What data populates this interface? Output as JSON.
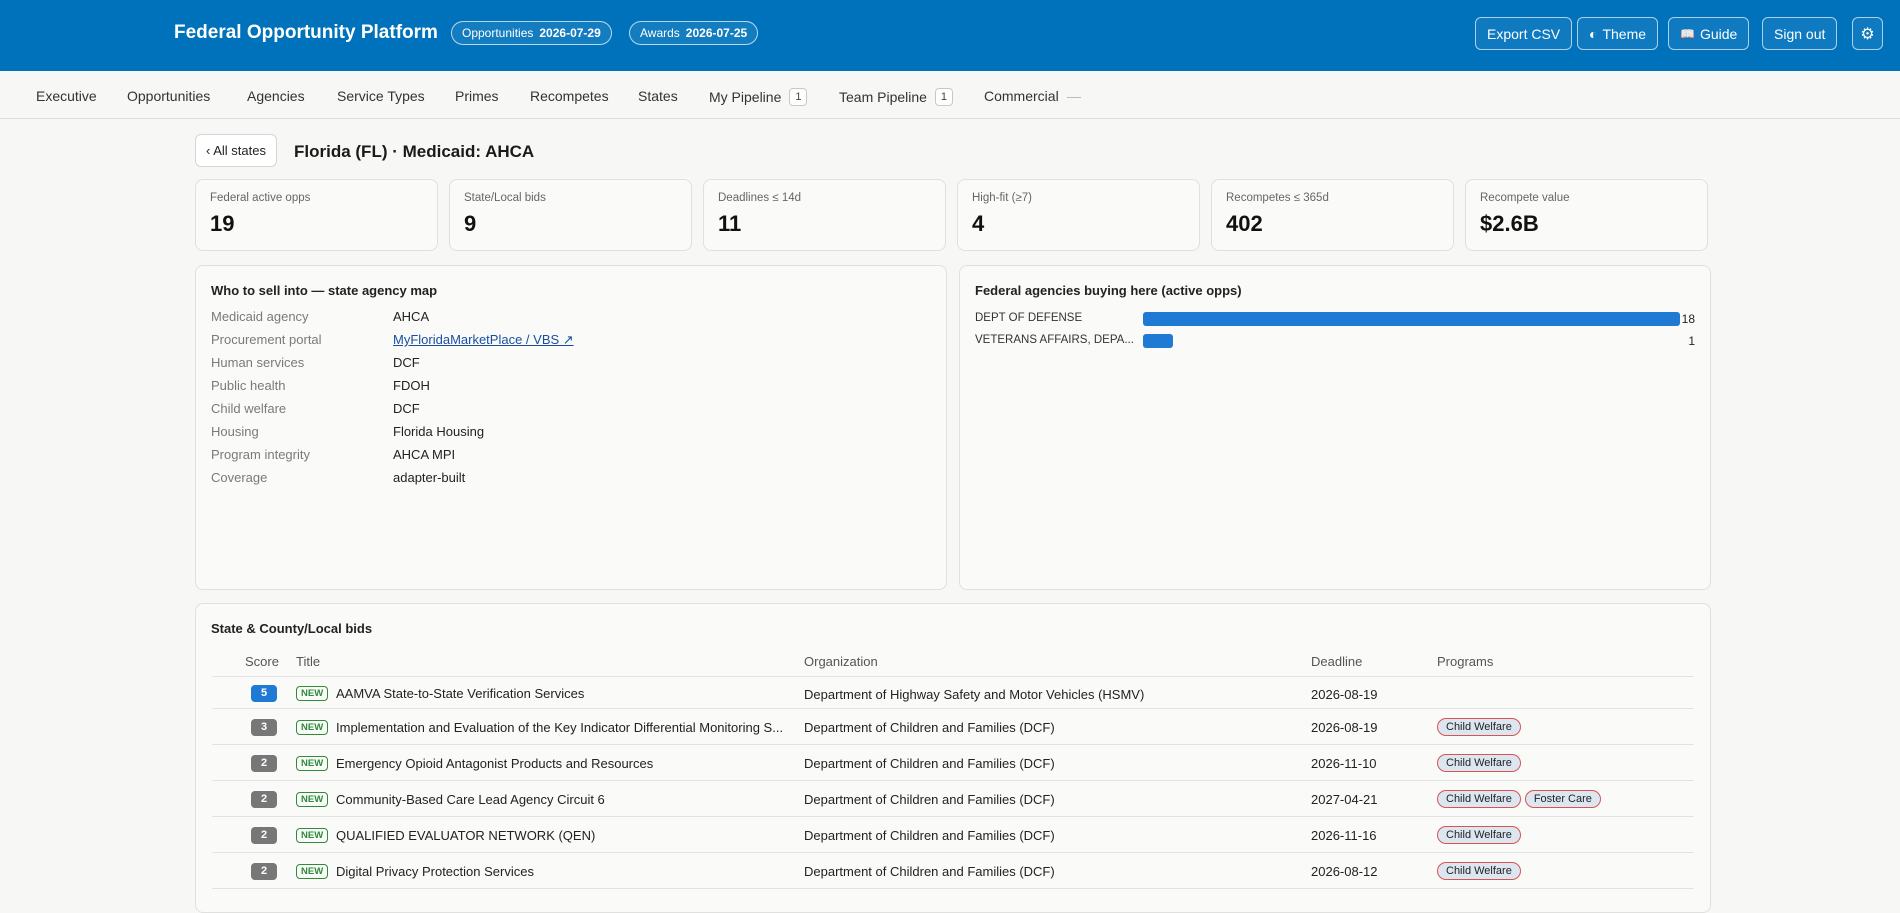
{
  "header": {
    "title": "Federal Opportunity Platform",
    "pills": [
      {
        "label": "Opportunities",
        "date": "2026-07-29"
      },
      {
        "label": "Awards",
        "date": "2026-07-25"
      }
    ],
    "buttons": {
      "export": "Export CSV",
      "theme": "Theme",
      "guide": "Guide",
      "signout": "Sign out"
    },
    "icons": {
      "theme": "◐",
      "guide": "📖",
      "settings": "⚙"
    }
  },
  "nav": {
    "items": [
      {
        "label": "Executive"
      },
      {
        "label": "Opportunities"
      },
      {
        "label": "Agencies"
      },
      {
        "label": "Service Types"
      },
      {
        "label": "Primes"
      },
      {
        "label": "Recompetes"
      },
      {
        "label": "States"
      },
      {
        "label": "My Pipeline",
        "badge": "1"
      },
      {
        "label": "Team Pipeline",
        "badge": "1"
      },
      {
        "label": "Commercial"
      }
    ]
  },
  "page": {
    "back_label": "‹ All states",
    "title": "Florida (FL) · Medicaid: AHCA"
  },
  "kpis": [
    {
      "label": "Federal active opps",
      "value": "19"
    },
    {
      "label": "State/Local bids",
      "value": "9"
    },
    {
      "label": "Deadlines ≤ 14d",
      "value": "11"
    },
    {
      "label": "High-fit (≥7)",
      "value": "4"
    },
    {
      "label": "Recompetes ≤ 365d",
      "value": "402"
    },
    {
      "label": "Recompete value",
      "value": "$2.6B"
    }
  ],
  "agency_map": {
    "title": "Who to sell into — state agency map",
    "rows": [
      {
        "key": "Medicaid agency",
        "value": "AHCA"
      },
      {
        "key": "Procurement portal",
        "value": "MyFloridaMarketPlace / VBS ↗"
      },
      {
        "key": "Human services",
        "value": "DCF"
      },
      {
        "key": "Public health",
        "value": "FDOH"
      },
      {
        "key": "Child welfare",
        "value": "DCF"
      },
      {
        "key": "Housing",
        "value": "Florida Housing"
      },
      {
        "key": "Program integrity",
        "value": "AHCA MPI"
      },
      {
        "key": "Coverage",
        "value": "adapter-built"
      }
    ]
  },
  "federal_agencies": {
    "title": "Federal agencies buying here (active opps)"
  },
  "chart_data": {
    "type": "bar",
    "orientation": "horizontal",
    "categories": [
      "DEPT OF DEFENSE",
      "VETERANS AFFAIRS, DEPA..."
    ],
    "values": [
      18,
      1
    ],
    "title": "Federal agencies buying here (active opps)",
    "xlim": [
      0,
      18
    ],
    "colors": {
      "bar": "#1f7ad4"
    }
  },
  "bids": {
    "title": "State & County/Local bids",
    "columns": {
      "score": "Score",
      "title": "Title",
      "organization": "Organization",
      "deadline": "Deadline",
      "programs": "Programs"
    },
    "new_label": "NEW",
    "rows": [
      {
        "score": "5",
        "title": "AAMVA State-to-State Verification Services",
        "organization": "Department of Highway Safety and Motor Vehicles (HSMV)",
        "deadline": "2026-08-19",
        "programs": []
      },
      {
        "score": "3",
        "title": "Implementation and Evaluation of the Key Indicator Differential Monitoring S...",
        "organization": "Department of Children and Families (DCF)",
        "deadline": "2026-08-19",
        "programs": [
          "Child Welfare"
        ]
      },
      {
        "score": "2",
        "title": "Emergency Opioid Antagonist Products and Resources",
        "organization": "Department of Children and Families (DCF)",
        "deadline": "2026-11-10",
        "programs": [
          "Child Welfare"
        ]
      },
      {
        "score": "2",
        "title": "Community-Based Care Lead Agency Circuit 6",
        "organization": "Department of Children and Families (DCF)",
        "deadline": "2027-04-21",
        "programs": [
          "Child Welfare",
          "Foster Care"
        ]
      },
      {
        "score": "2",
        "title": "QUALIFIED EVALUATOR NETWORK (QEN)",
        "organization": "Department of Children and Families (DCF)",
        "deadline": "2026-11-16",
        "programs": [
          "Child Welfare"
        ]
      },
      {
        "score": "2",
        "title": "Digital Privacy Protection Services",
        "organization": "Department of Children and Families (DCF)",
        "deadline": "2026-08-12",
        "programs": [
          "Child Welfare"
        ]
      }
    ]
  }
}
